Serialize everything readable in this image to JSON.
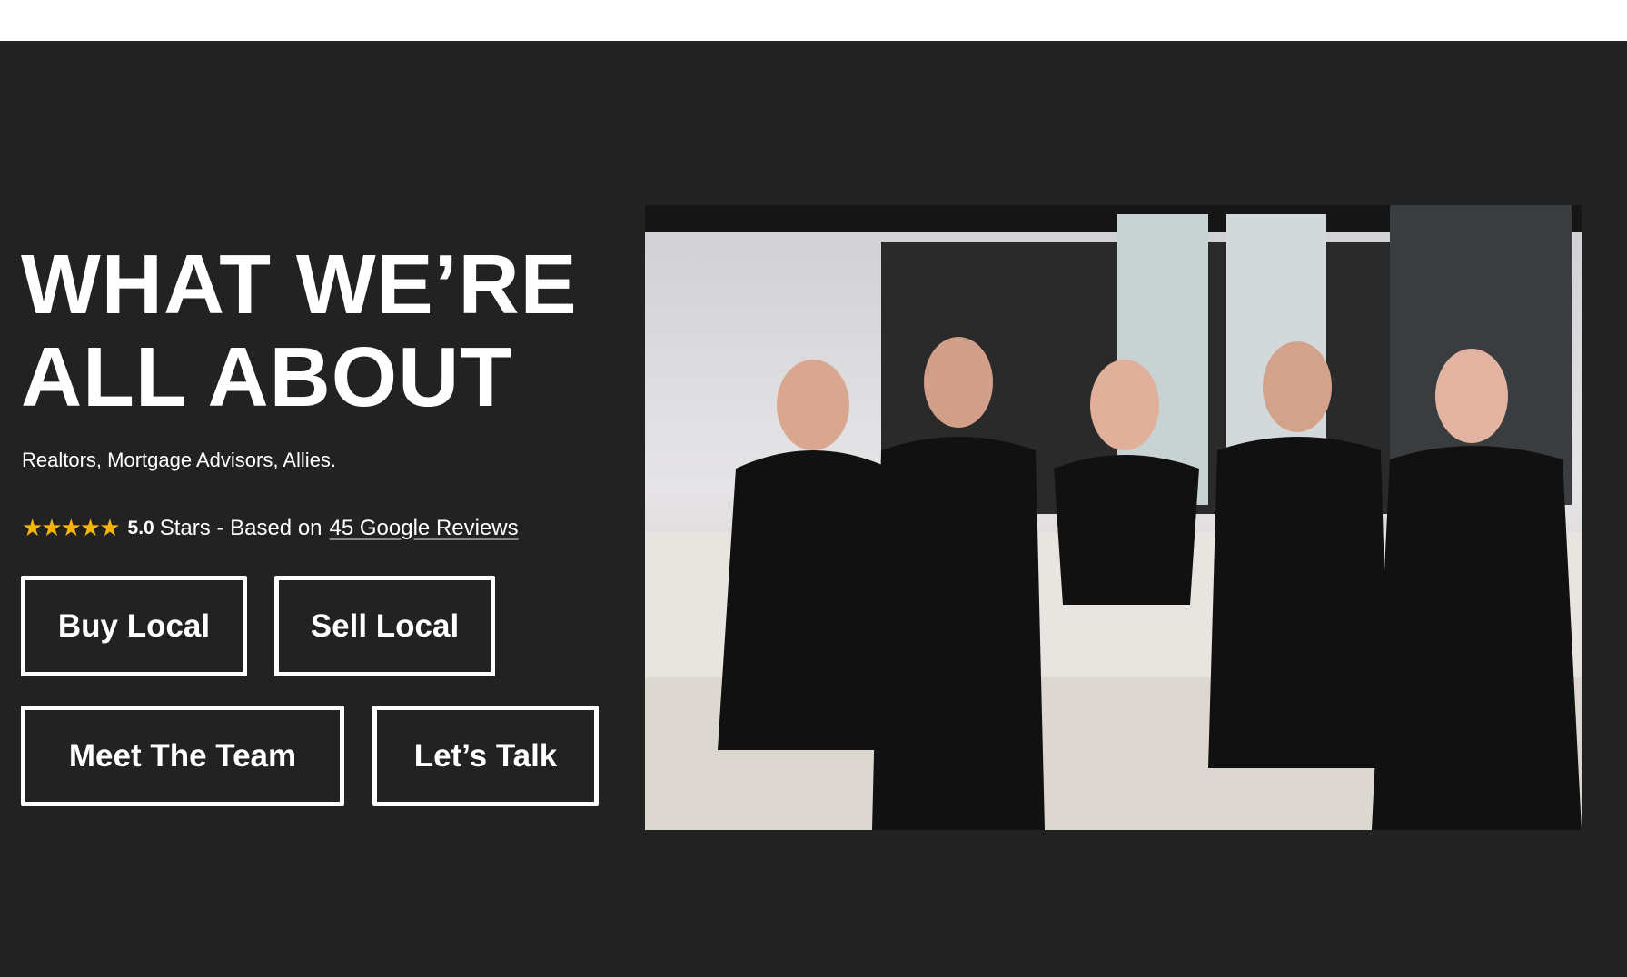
{
  "heading": {
    "line1": "WHAT WE’RE",
    "line2": "ALL ABOUT"
  },
  "subtitle": "Realtors, Mortgage Advisors, Allies.",
  "rating": {
    "stars": "★★★★★",
    "score": "5.0",
    "text": "Stars - Based on",
    "link": "45 Google Reviews"
  },
  "buttons": {
    "buy": "Buy Local",
    "sell": "Sell Local",
    "team": "Meet The Team",
    "talk": "Let’s Talk"
  },
  "colors": {
    "background": "#222222",
    "star": "#f5b50a"
  }
}
